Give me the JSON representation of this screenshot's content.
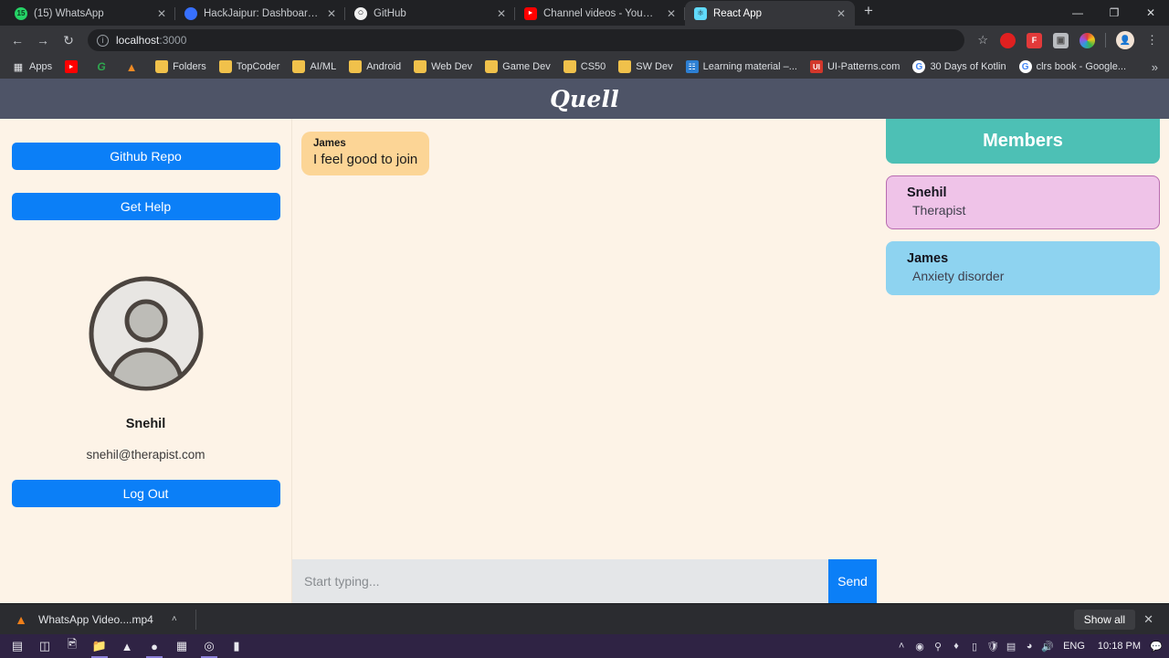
{
  "browser": {
    "tabs": [
      {
        "title": "(15) WhatsApp",
        "favicon": "whatsapp-icon",
        "active": false
      },
      {
        "title": "HackJaipur: Dashboard | Devfolio",
        "favicon": "devfolio-icon",
        "active": false
      },
      {
        "title": "GitHub",
        "favicon": "github-icon",
        "active": false
      },
      {
        "title": "Channel videos - YouTube Studio",
        "favicon": "youtube-icon",
        "active": false
      },
      {
        "title": "React App",
        "favicon": "react-icon",
        "active": true
      }
    ],
    "new_tab_label": "+",
    "window_controls": {
      "minimize": "—",
      "maximize": "❐",
      "close": "✕"
    },
    "nav": {
      "back": "←",
      "forward": "→",
      "reload": "↻"
    },
    "omnibox": {
      "host": "localhost",
      "port": ":3000",
      "info_icon": "ⓘ"
    },
    "star_icon": "☆",
    "kebab_icon": "⋮",
    "bookmarks": [
      {
        "label": "Apps",
        "icon": "apps-grid-icon"
      },
      {
        "label": "",
        "icon": "youtube-icon"
      },
      {
        "label": "",
        "icon": "grammarly-icon"
      },
      {
        "label": "",
        "icon": "brave-icon"
      },
      {
        "label": "Folders",
        "icon": "folder-icon"
      },
      {
        "label": "TopCoder",
        "icon": "folder-icon"
      },
      {
        "label": "AI/ML",
        "icon": "folder-icon"
      },
      {
        "label": "Android",
        "icon": "folder-icon"
      },
      {
        "label": "Web Dev",
        "icon": "folder-icon"
      },
      {
        "label": "Game Dev",
        "icon": "folder-icon"
      },
      {
        "label": "CS50",
        "icon": "folder-icon"
      },
      {
        "label": "SW Dev",
        "icon": "folder-icon"
      },
      {
        "label": "Learning material –...",
        "icon": "learning-icon"
      },
      {
        "label": "UI-Patterns.com",
        "icon": "ui-patterns-icon"
      },
      {
        "label": "30 Days of Kotlin",
        "icon": "google-icon"
      },
      {
        "label": "clrs book - Google...",
        "icon": "google-icon"
      }
    ],
    "bookmarks_overflow": "»"
  },
  "app": {
    "brand": "Quell",
    "colors": {
      "header_bg": "#4e5467",
      "page_bg": "#fdf3e7",
      "accent_blue": "#0b7ff7",
      "members_header": "#4dc0b5",
      "self_card": "#efc3e8",
      "other_card": "#8ed3f0",
      "bubble": "#fcd596"
    },
    "sidebar": {
      "github_repo_label": "Github Repo",
      "get_help_label": "Get Help",
      "profile": {
        "avatar_icon": "user-avatar-icon",
        "name": "Snehil",
        "email": "snehil@therapist.com"
      },
      "logout_label": "Log Out"
    },
    "chat": {
      "messages": [
        {
          "author": "James",
          "text": "I feel good to join"
        }
      ],
      "composer": {
        "placeholder": "Start typing...",
        "value": "",
        "send_label": "Send"
      }
    },
    "members": {
      "title": "Members",
      "list": [
        {
          "name": "Snehil",
          "role": "Therapist",
          "self": true
        },
        {
          "name": "James",
          "role": "Anxiety disorder",
          "self": false
        }
      ]
    }
  },
  "downloads": {
    "file_name": "WhatsApp Video....mp4",
    "file_icon": "vlc-cone-icon",
    "caret": "˄",
    "show_all_label": "Show all",
    "close_icon": "✕"
  },
  "taskbar": {
    "items": [
      {
        "icon": "windows-start-icon",
        "running": false
      },
      {
        "icon": "task-view-icon",
        "running": false
      },
      {
        "icon": "photos-icon",
        "running": false
      },
      {
        "icon": "file-explorer-icon",
        "running": true
      },
      {
        "icon": "vlc-icon",
        "running": false
      },
      {
        "icon": "chrome-icon",
        "running": true
      },
      {
        "icon": "calculator-icon",
        "running": false
      },
      {
        "icon": "app-icon",
        "running": true
      },
      {
        "icon": "terminal-icon",
        "running": false
      }
    ],
    "tray": {
      "expand": "˄",
      "icons": [
        "nvidia-icon",
        "search-icon",
        "bluetooth-icon",
        "battery-icon",
        "security-icon",
        "device-icon",
        "network-icon",
        "volume-icon"
      ],
      "language": "ENG",
      "time": "10:18 PM",
      "notifications_icon": "notification-icon"
    }
  }
}
